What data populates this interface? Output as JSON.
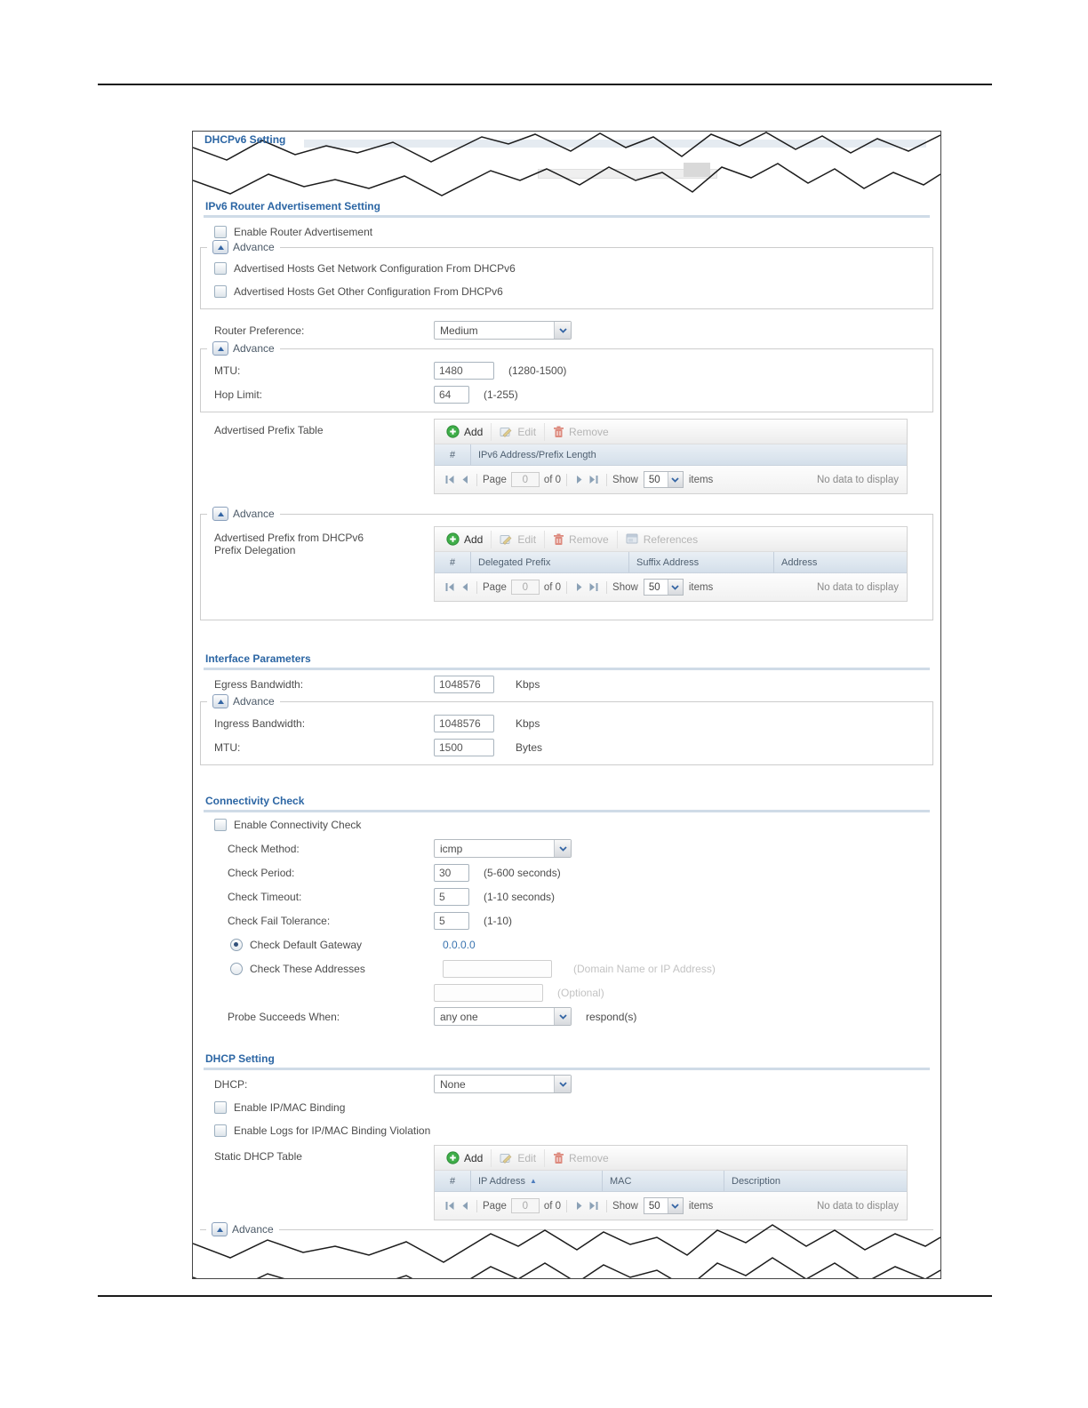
{
  "colors": {
    "header_blue": "#2c66a4",
    "value_blue": "#3a74b0",
    "add_green": "#3fae49",
    "remove_red": "#dd8a7e",
    "table_header_bg": "#d8e2ec"
  },
  "common": {
    "advance": "Advance"
  },
  "dhcpv6": {
    "title": "DHCPv6 Setting"
  },
  "ra": {
    "title": "IPv6 Router Advertisement Setting",
    "enable": "Enable Router Advertisement",
    "hosts_network": "Advertised Hosts Get Network Configuration From DHCPv6",
    "hosts_other": "Advertised Hosts Get Other Configuration From DHCPv6",
    "router_preference_label": "Router Preference:",
    "router_preference_value": "Medium",
    "mtu_label": "MTU:",
    "mtu_value": "1480",
    "mtu_range": "(1280-1500)",
    "hop_limit_label": "Hop Limit:",
    "hop_limit_value": "64",
    "hop_limit_range": "(1-255)",
    "advertised_prefix_table_label": "Advertised Prefix Table",
    "delegation_label": "Advertised Prefix from DHCPv6 Prefix Delegation"
  },
  "toolbar": {
    "add": "Add",
    "edit": "Edit",
    "remove": "Remove",
    "references": "References"
  },
  "tables": {
    "adv_prefix_columns": [
      "#",
      "IPv6 Address/Prefix Length"
    ],
    "delegation_columns": [
      "#",
      "Delegated Prefix",
      "Suffix Address",
      "Address"
    ],
    "static_dhcp_columns": [
      "#",
      "IP Address",
      "MAC",
      "Description"
    ]
  },
  "pagination": {
    "page_label": "Page",
    "page_value": "0",
    "of_label": "of 0",
    "show_label": "Show",
    "page_size": "50",
    "items_label": "items",
    "no_data": "No data to display"
  },
  "interface_params": {
    "title": "Interface Parameters",
    "egress_label": "Egress Bandwidth:",
    "egress_value": "1048576",
    "egress_unit": "Kbps",
    "ingress_label": "Ingress Bandwidth:",
    "ingress_value": "1048576",
    "ingress_unit": "Kbps",
    "mtu_label": "MTU:",
    "mtu_value": "1500",
    "mtu_unit": "Bytes"
  },
  "connectivity": {
    "title": "Connectivity Check",
    "enable": "Enable Connectivity Check",
    "method_label": "Check Method:",
    "method_value": "icmp",
    "period_label": "Check Period:",
    "period_value": "30",
    "period_range": "(5-600 seconds)",
    "timeout_label": "Check Timeout:",
    "timeout_value": "5",
    "timeout_range": "(1-10 seconds)",
    "fail_label": "Check Fail Tolerance:",
    "fail_value": "5",
    "fail_range": "(1-10)",
    "default_gateway_label": "Check Default Gateway",
    "default_gateway_value": "0.0.0.0",
    "these_addresses_label": "Check These Addresses",
    "address_hint": "(Domain Name or IP Address)",
    "optional_hint": "(Optional)",
    "probe_label": "Probe Succeeds When:",
    "probe_value": "any one",
    "probe_suffix": "respond(s)"
  },
  "dhcp": {
    "title": "DHCP Setting",
    "dhcp_label": "DHCP:",
    "dhcp_value": "None",
    "ip_mac_binding": "Enable IP/MAC Binding",
    "ip_mac_logs": "Enable Logs for IP/MAC Binding Violation",
    "static_table_label": "Static DHCP Table"
  }
}
